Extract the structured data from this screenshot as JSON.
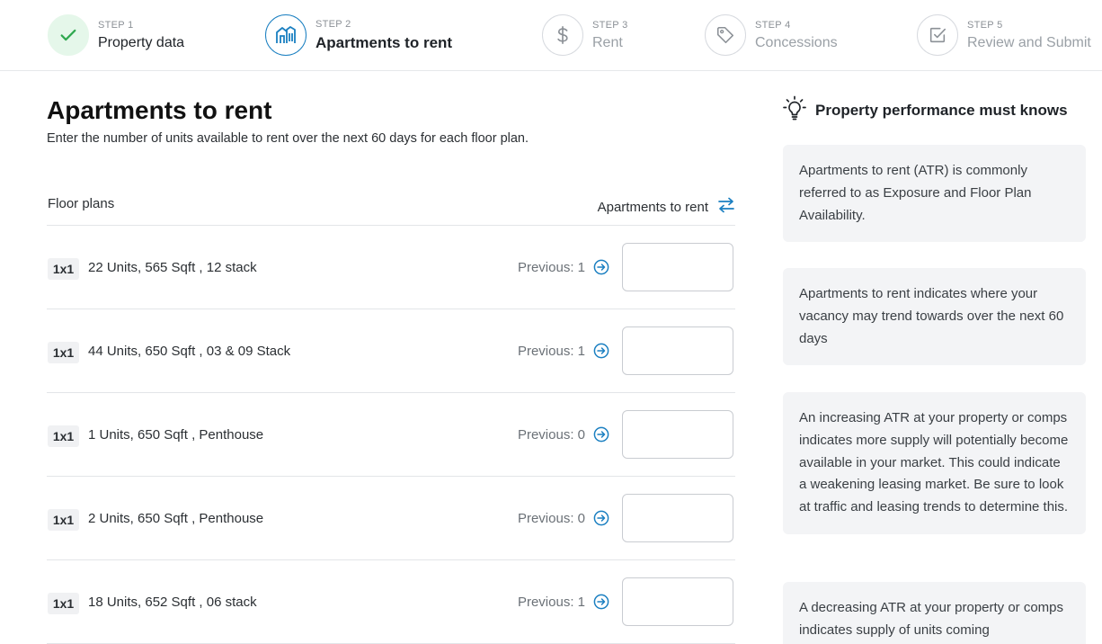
{
  "stepper": {
    "steps": [
      {
        "number_label": "STEP 1",
        "title": "Property data",
        "state": "completed",
        "icon": "check-icon"
      },
      {
        "number_label": "STEP 2",
        "title": "Apartments to rent",
        "state": "current",
        "icon": "building-icon"
      },
      {
        "number_label": "STEP 3",
        "title": "Rent",
        "state": "upcoming",
        "icon": "dollar-icon"
      },
      {
        "number_label": "STEP 4",
        "title": "Concessions",
        "state": "upcoming",
        "icon": "tag-icon"
      },
      {
        "number_label": "STEP 5",
        "title": "Review and Submit",
        "state": "upcoming",
        "icon": "checkbox-icon"
      }
    ]
  },
  "main": {
    "title": "Apartments to rent",
    "subtitle": "Enter the number of units available to rent over the next 60 days for each floor plan.",
    "table": {
      "col_floor_plans": "Floor plans",
      "col_atr": "Apartments to rent",
      "rows": [
        {
          "badge": "1x1",
          "description": "22 Units, 565 Sqft , 12 stack",
          "previous": "Previous: 1",
          "value": ""
        },
        {
          "badge": "1x1",
          "description": "44 Units, 650 Sqft , 03 & 09 Stack",
          "previous": "Previous: 1",
          "value": ""
        },
        {
          "badge": "1x1",
          "description": "1 Units, 650 Sqft , Penthouse",
          "previous": "Previous: 0",
          "value": ""
        },
        {
          "badge": "1x1",
          "description": "2 Units, 650 Sqft , Penthouse",
          "previous": "Previous: 0",
          "value": ""
        },
        {
          "badge": "1x1",
          "description": "18 Units, 652 Sqft , 06 stack",
          "previous": "Previous: 1",
          "value": ""
        }
      ]
    }
  },
  "side": {
    "title": "Property performance must knows",
    "cards": [
      "Apartments to rent (ATR) is commonly referred to as Exposure and Floor Plan Availability.",
      "Apartments to rent indicates where your vacancy may trend towards over the next 60 days",
      "An increasing ATR at your property or comps indicates more supply will potentially become available in your market. This could indicate a weakening leasing market. Be sure to look at traffic and leasing trends to determine this.",
      "A decreasing ATR at your property or comps indicates supply of units coming"
    ]
  },
  "colors": {
    "accent": "#1a7fc1",
    "success": "#2fa84f",
    "success_bg": "#e5f7ea",
    "card_bg": "#f3f4f6"
  }
}
